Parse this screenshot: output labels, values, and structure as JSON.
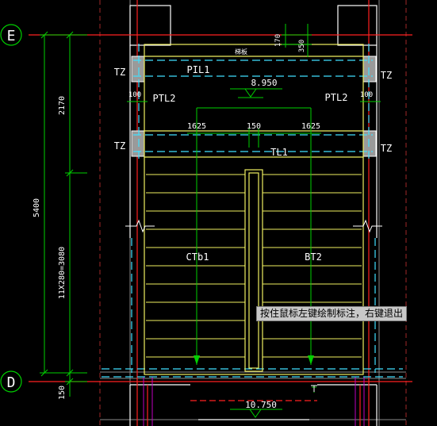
{
  "grid_axes": {
    "top": "E",
    "bottom": "D"
  },
  "dimensions": {
    "total": "5400",
    "upper": "2170",
    "stairs": "11X280=3080",
    "bottom": "150",
    "top_a": "170",
    "top_b": "350",
    "left_100": "100",
    "right_100": "100",
    "flight_left": "1625",
    "gap": "150",
    "flight_right": "1625"
  },
  "elevations": {
    "upper": "8.950",
    "lower": "10.750"
  },
  "labels": {
    "tz_top_left": "TZ",
    "tz_top_right": "TZ",
    "tz_bottom_left": "TZ",
    "tz_bottom_right": "TZ",
    "pil1": "PIL1",
    "ptl2_left": "PTL2",
    "ptl2_right": "PTL2",
    "tl1": "TL1",
    "ctb1": "CTb1",
    "bt2": "BT2",
    "top_beam": "梯板"
  },
  "status": {
    "prompt": "按住鼠标左键绘制标注，右键退出"
  },
  "colors": {
    "background": "#000000",
    "axis_red": "#ff2020",
    "dim_green": "#00d000",
    "wall_white": "#ffffff",
    "stair_yellow": "#f0f060",
    "cyan": "#40e0ff",
    "magenta": "#c000c0",
    "gray": "#8a8a8a"
  }
}
